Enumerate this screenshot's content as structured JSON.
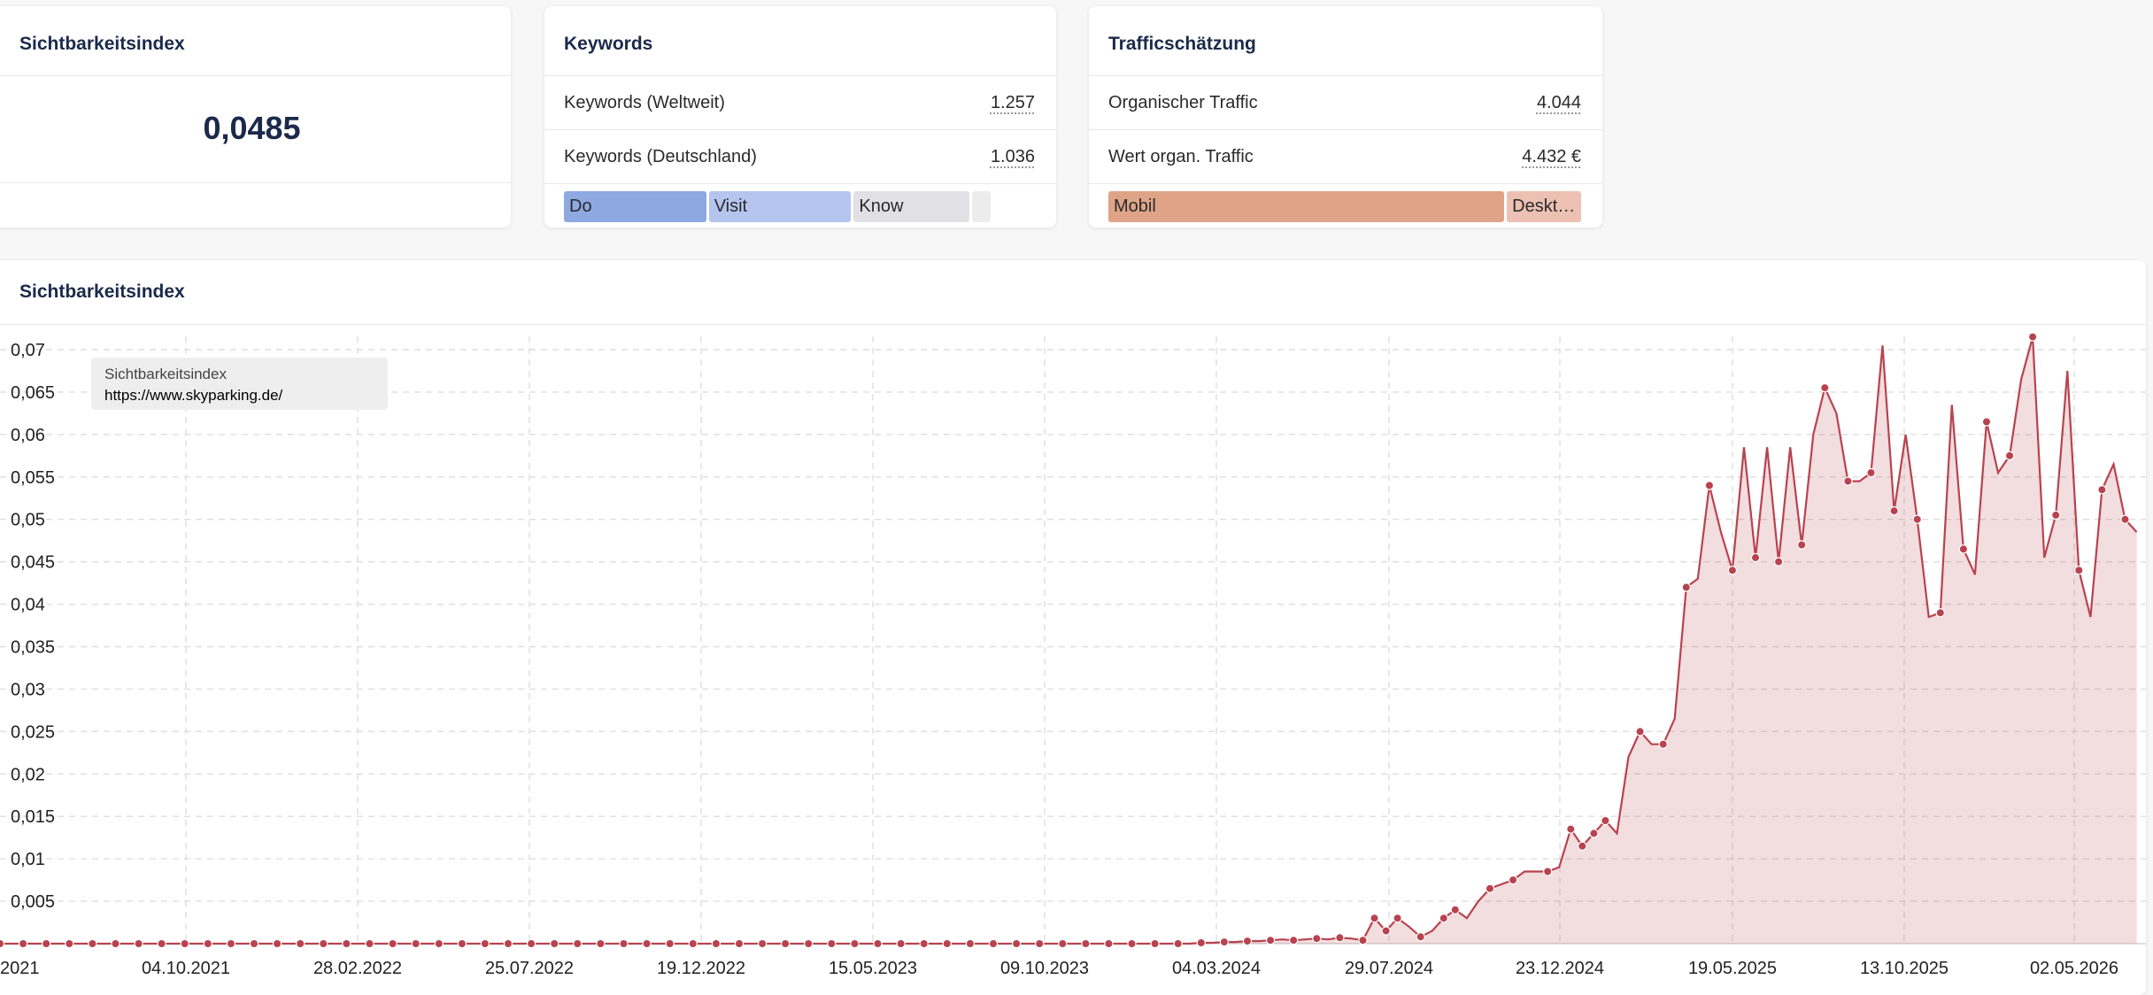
{
  "visibility_card": {
    "title": "Sichtbarkeitsindex",
    "value": "0,0485"
  },
  "keywords_card": {
    "title": "Keywords",
    "rows": [
      {
        "label": "Keywords (Weltweit)",
        "value": "1.257"
      },
      {
        "label": "Keywords (Deutschland)",
        "value": "1.036"
      }
    ],
    "intent_bar": [
      {
        "label": "Do",
        "share": 0.31,
        "color": "#8ea9e2"
      },
      {
        "label": "Visit",
        "share": 0.31,
        "color": "#b4c5ef"
      },
      {
        "label": "Know",
        "share": 0.25,
        "color": "#e0e0e5"
      },
      {
        "label": "",
        "share": 0.03,
        "color": "#ececec"
      }
    ]
  },
  "traffic_card": {
    "title": "Trafficschätzung",
    "rows": [
      {
        "label": "Organischer Traffic",
        "value": "4.044"
      },
      {
        "label": "Wert organ. Traffic",
        "value": "4.432 €"
      }
    ],
    "device_bar": [
      {
        "label": "Mobil",
        "share": 0.85,
        "color": "#dfa487"
      },
      {
        "label": "Deskt…",
        "share": 0.15,
        "color": "#ecc0b3"
      }
    ]
  },
  "chart_card": {
    "title": "Sichtbarkeitsindex",
    "legend": {
      "series": "Sichtbarkeitsindex",
      "url": "https://www.skyparking.de/"
    }
  },
  "chart_data": {
    "type": "line",
    "series_name": "Sichtbarkeitsindex",
    "fill": true,
    "color": "#b8434f",
    "y_ticks": [
      "0,07",
      "0,065",
      "0,06",
      "0,055",
      "0,05",
      "0,045",
      "0,04",
      "0,035",
      "0,03",
      "0,025",
      "0,02",
      "0,015",
      "0,01",
      "0,005"
    ],
    "y_range": [
      0,
      0.07
    ],
    "x_tick_labels": [
      "2021",
      "04.10.2021",
      "28.02.2022",
      "25.07.2022",
      "19.12.2022",
      "15.05.2023",
      "09.10.2023",
      "04.03.2024",
      "29.07.2024",
      "23.12.2024",
      "19.05.2025",
      "13.10.2025",
      "02.05.2026"
    ],
    "x_index_range": [
      0,
      172
    ],
    "tick_indices": [
      0,
      14,
      28,
      42,
      56,
      70,
      84,
      98,
      112,
      126,
      140,
      154,
      170
    ],
    "baseline_points": {
      "from_index": 0,
      "to_index": 104,
      "value": 0.0
    },
    "points": [
      [
        104,
        0.0001
      ],
      [
        105,
        0.0001
      ],
      [
        106,
        0.0002
      ],
      [
        107,
        0.0002
      ],
      [
        108,
        0.0003
      ],
      [
        109,
        0.0003
      ],
      [
        110,
        0.0004
      ],
      [
        111,
        0.0005
      ],
      [
        112,
        0.0004
      ],
      [
        113,
        0.0005
      ],
      [
        114,
        0.0006
      ],
      [
        115,
        0.0005
      ],
      [
        116,
        0.0007
      ],
      [
        117,
        0.0006
      ],
      [
        118,
        0.0004
      ],
      [
        119,
        0.003
      ],
      [
        120,
        0.0015
      ],
      [
        121,
        0.003
      ],
      [
        122,
        0.002
      ],
      [
        123,
        0.0008
      ],
      [
        124,
        0.0015
      ],
      [
        125,
        0.003
      ],
      [
        126,
        0.004
      ],
      [
        127,
        0.003
      ],
      [
        128,
        0.005
      ],
      [
        129,
        0.0065
      ],
      [
        130,
        0.007
      ],
      [
        131,
        0.0075
      ],
      [
        132,
        0.0085
      ],
      [
        133,
        0.0085
      ],
      [
        134,
        0.0085
      ],
      [
        135,
        0.009
      ],
      [
        136,
        0.0135
      ],
      [
        137,
        0.0115
      ],
      [
        138,
        0.013
      ],
      [
        139,
        0.0145
      ],
      [
        140,
        0.013
      ],
      [
        141,
        0.022
      ],
      [
        142,
        0.025
      ],
      [
        143,
        0.0235
      ],
      [
        144,
        0.0235
      ],
      [
        145,
        0.0265
      ],
      [
        146,
        0.042
      ],
      [
        147,
        0.043
      ],
      [
        148,
        0.054
      ],
      [
        149,
        0.0485
      ],
      [
        150,
        0.044
      ],
      [
        151,
        0.0585
      ],
      [
        152,
        0.0455
      ],
      [
        153,
        0.0585
      ],
      [
        154,
        0.045
      ],
      [
        155,
        0.0585
      ],
      [
        156,
        0.047
      ],
      [
        157,
        0.06
      ],
      [
        158,
        0.0655
      ],
      [
        159,
        0.0625
      ],
      [
        160,
        0.0545
      ],
      [
        161,
        0.0545
      ],
      [
        162,
        0.0555
      ],
      [
        163,
        0.0705
      ],
      [
        164,
        0.051
      ],
      [
        165,
        0.06
      ],
      [
        166,
        0.05
      ],
      [
        167,
        0.0385
      ],
      [
        168,
        0.039
      ],
      [
        169,
        0.0635
      ],
      [
        170,
        0.0465
      ],
      [
        171,
        0.0435
      ],
      [
        172,
        0.0615
      ],
      [
        173,
        0.0555
      ],
      [
        174,
        0.0575
      ],
      [
        175,
        0.0665
      ],
      [
        176,
        0.0715
      ],
      [
        177,
        0.0455
      ],
      [
        178,
        0.0505
      ],
      [
        179,
        0.0675
      ],
      [
        180,
        0.044
      ],
      [
        181,
        0.0385
      ],
      [
        182,
        0.0535
      ],
      [
        183,
        0.0565
      ],
      [
        184,
        0.05
      ],
      [
        185,
        0.0485
      ]
    ],
    "highlighted_point_indices": [
      104,
      106,
      108,
      110,
      112,
      114,
      116,
      118,
      119,
      120,
      121,
      123,
      125,
      126,
      129,
      131,
      134,
      136,
      137,
      138,
      139,
      142,
      144,
      146,
      148,
      150,
      152,
      154,
      156,
      158,
      160,
      162,
      164,
      166,
      168,
      170,
      172,
      174,
      176,
      178,
      180,
      182,
      184
    ]
  }
}
